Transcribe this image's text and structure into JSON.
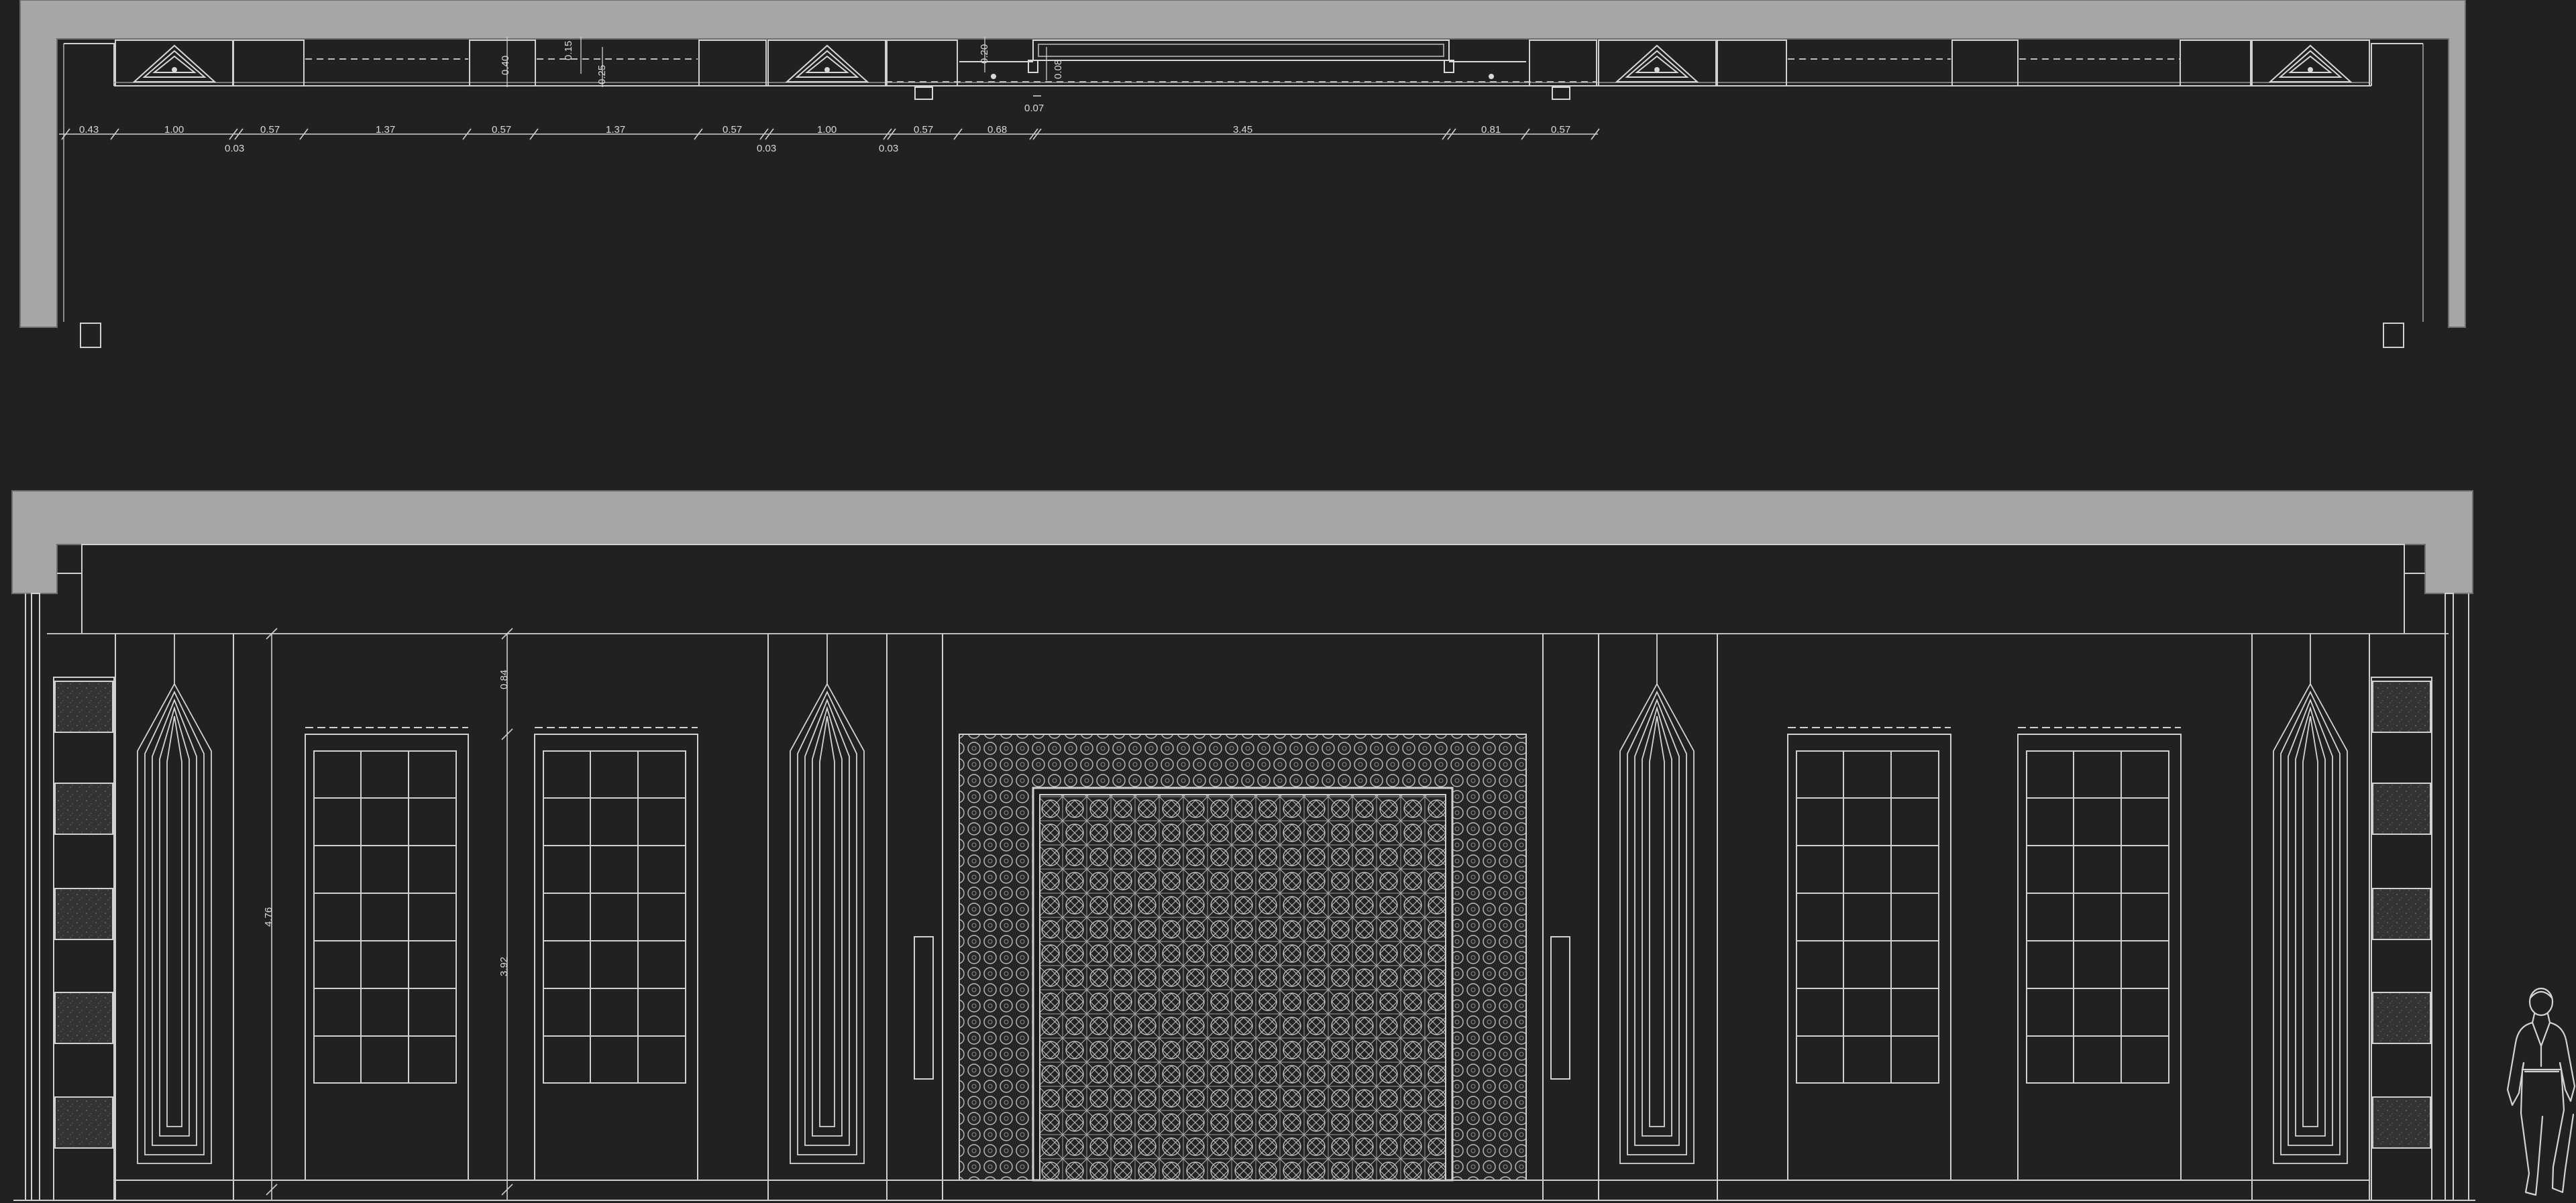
{
  "drawing": {
    "plan_dimensions_top": [
      "0.43",
      "1.00",
      "0.57",
      "1.37",
      "0.57",
      "1.37",
      "0.57",
      "1.00",
      "0.57",
      "0.68",
      "3.45",
      "0.81",
      "0.57"
    ],
    "plan_dimensions_bottom": [
      "0.03",
      "0.03",
      "0.03",
      "0.07"
    ],
    "plan_dimensions_vertical": [
      "0.40",
      "0.15",
      "0.25",
      "0.20",
      "0.08"
    ],
    "elevation_heights": [
      "0.84",
      "4.76",
      "3.92"
    ]
  },
  "colors": {
    "background": "#212121",
    "wall_fill": "#a6a6a6",
    "line": "#d0d0d0",
    "stone_panel": "#3a3a3a"
  }
}
